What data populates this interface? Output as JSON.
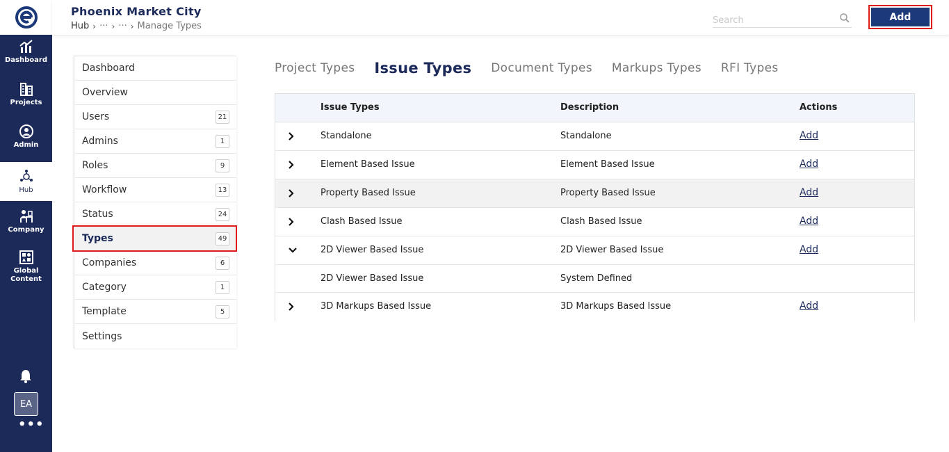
{
  "rail": {
    "items": [
      {
        "label": "Dashboard",
        "icon": "chart-icon"
      },
      {
        "label": "Projects",
        "icon": "building-icon"
      },
      {
        "label": "Admin",
        "icon": "user-circle-icon"
      },
      {
        "label": "Hub",
        "icon": "hub-icon"
      },
      {
        "label": "Company",
        "icon": "desk-user-icon"
      },
      {
        "label": "Global Content",
        "icon": "grid-icon"
      }
    ],
    "avatar": "EA",
    "more": "•••"
  },
  "header": {
    "title": "Phoenix Market City",
    "breadcrumb": [
      "Hub",
      "···",
      "···",
      "Manage Types"
    ],
    "search_placeholder": "Search",
    "add_label": "Add"
  },
  "menu": {
    "items": [
      {
        "label": "Dashboard",
        "count": ""
      },
      {
        "label": "Overview",
        "count": ""
      },
      {
        "label": "Users",
        "count": "21"
      },
      {
        "label": "Admins",
        "count": "1"
      },
      {
        "label": "Roles",
        "count": "9"
      },
      {
        "label": "Workflow",
        "count": "13"
      },
      {
        "label": "Status",
        "count": "24"
      },
      {
        "label": "Types",
        "count": "49"
      },
      {
        "label": "Companies",
        "count": "6"
      },
      {
        "label": "Category",
        "count": "1"
      },
      {
        "label": "Template",
        "count": "5"
      },
      {
        "label": "Settings",
        "count": ""
      }
    ]
  },
  "tabs": [
    "Project Types",
    "Issue Types",
    "Document Types",
    "Markups Types",
    "RFI Types"
  ],
  "table": {
    "headers": [
      "Issue Types",
      "Description",
      "Actions"
    ],
    "rows": [
      {
        "name": "Standalone",
        "description": "Standalone",
        "action": "Add"
      },
      {
        "name": "Element Based Issue",
        "description": "Element Based Issue",
        "action": "Add"
      },
      {
        "name": "Property Based Issue",
        "description": "Property Based Issue",
        "action": "Add"
      },
      {
        "name": "Clash Based Issue",
        "description": "Clash Based Issue",
        "action": "Add"
      },
      {
        "name": "2D Viewer Based Issue",
        "description": "2D Viewer Based Issue",
        "action": "Add"
      },
      {
        "name": "2D Viewer Based Issue",
        "description": "System Defined",
        "action": ""
      },
      {
        "name": "3D Markups Based Issue",
        "description": "3D Markups Based Issue",
        "action": "Add"
      }
    ]
  },
  "colors": {
    "brand": "#1c2a5a",
    "button": "#1c3a7a",
    "highlight": "#e01b1b"
  }
}
